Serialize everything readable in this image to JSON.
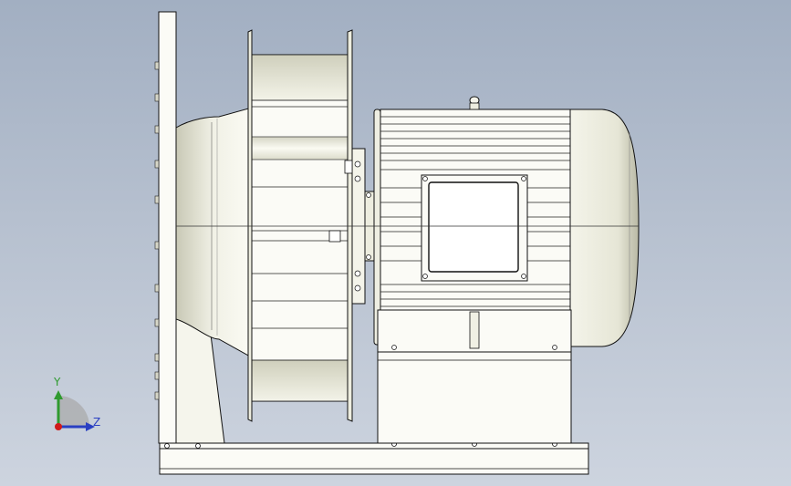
{
  "viewport": {
    "background_top": "#a2afc2",
    "background_bottom": "#cdd4df"
  },
  "model": {
    "parts": [
      "inlet-plate",
      "fan-impeller",
      "coupling-hub",
      "motor",
      "base-frame",
      "lifting-eye"
    ]
  },
  "triad": {
    "y_label": "Y",
    "z_label": "Z",
    "y_color": "#2f9a2f",
    "z_color": "#2a3fc2",
    "origin_color": "#d11a1a"
  }
}
